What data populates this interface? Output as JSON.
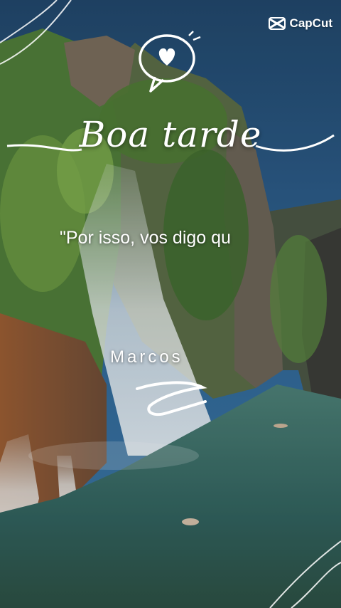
{
  "app": {
    "brand_name": "CapCut",
    "brand_icon": "capcut-logo-icon"
  },
  "card": {
    "greeting": "Boa tarde",
    "quote": "\"Por isso, vos digo qu",
    "author": "Marcos"
  },
  "decorations": {
    "heart_bubble": "heart-speech-bubble-icon",
    "squiggle": "squiggle-underline-icon",
    "corner_swirls": "swirl-decoration-icon"
  },
  "colors": {
    "sky": "#2c5a86",
    "text": "#ffffff",
    "foliage": "#5f8f3a",
    "water": "#3d6f6a"
  }
}
